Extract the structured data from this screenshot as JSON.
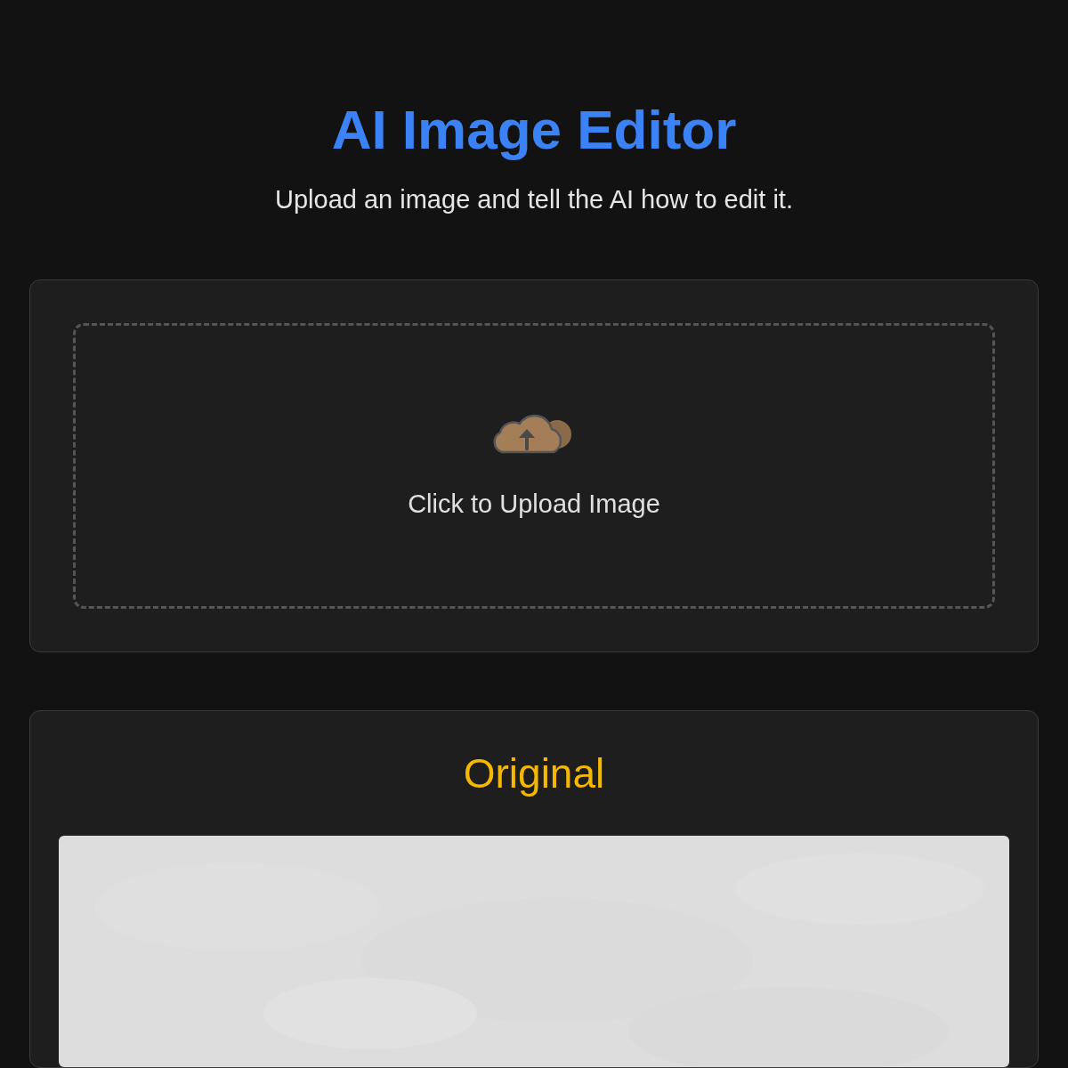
{
  "header": {
    "title": "AI Image Editor",
    "subtitle": "Upload an image and tell the AI how to edit it."
  },
  "upload": {
    "label": "Click to Upload Image"
  },
  "original": {
    "heading": "Original"
  }
}
